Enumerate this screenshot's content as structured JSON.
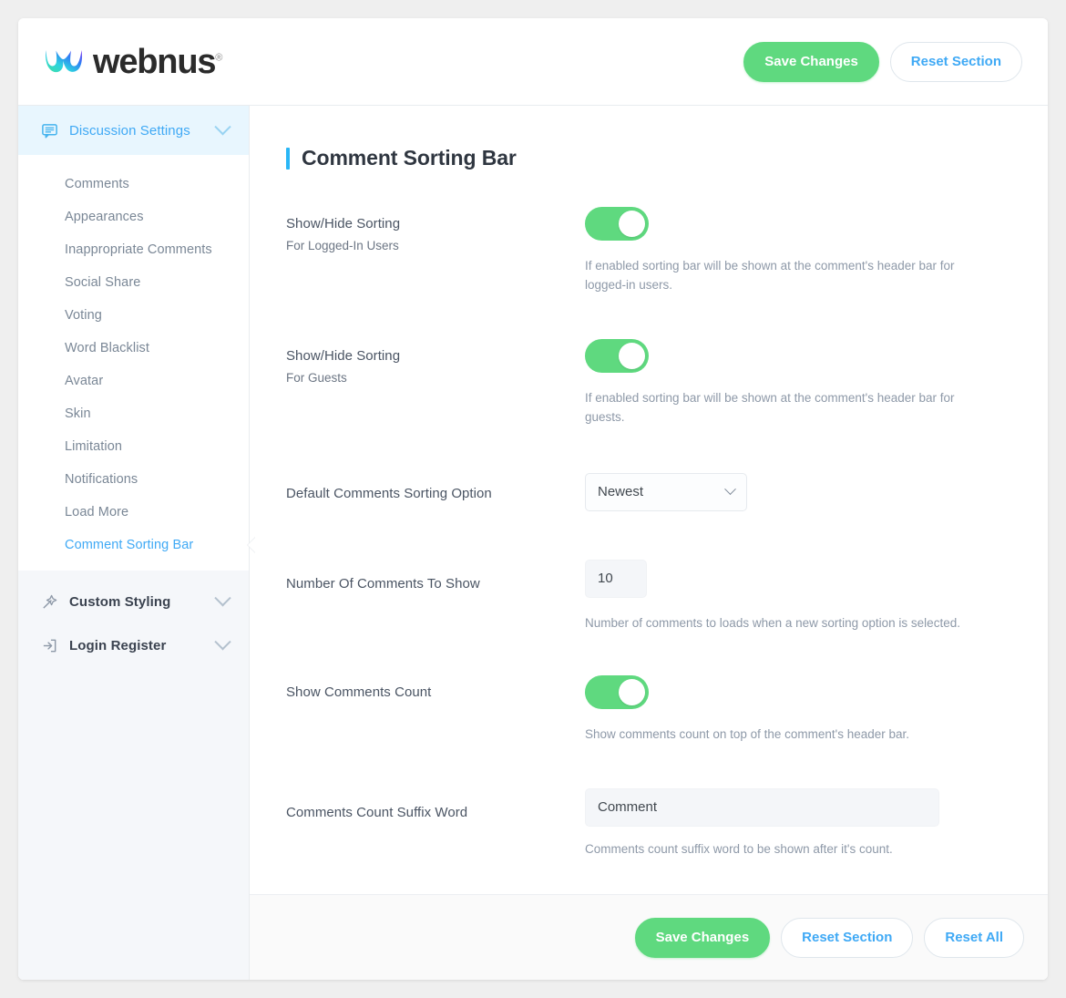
{
  "brand": {
    "name": "webnus",
    "registered_mark": "®",
    "logo_icon": "webnus-gradient-mark",
    "gradient": [
      "#3fe0a0",
      "#2ed3e0",
      "#2f7df5",
      "#8b3df0"
    ]
  },
  "topbar": {
    "save_label": "Save Changes",
    "reset_section_label": "Reset Section"
  },
  "sidebar": {
    "groups": [
      {
        "label": "Discussion Settings",
        "icon": "comment-bubble-icon",
        "active": true,
        "items": [
          {
            "label": "Comments",
            "active": false
          },
          {
            "label": "Appearances",
            "active": false
          },
          {
            "label": "Inappropriate Comments",
            "active": false
          },
          {
            "label": "Social Share",
            "active": false
          },
          {
            "label": "Voting",
            "active": false
          },
          {
            "label": "Word Blacklist",
            "active": false
          },
          {
            "label": "Avatar",
            "active": false
          },
          {
            "label": "Skin",
            "active": false
          },
          {
            "label": "Limitation",
            "active": false
          },
          {
            "label": "Notifications",
            "active": false
          },
          {
            "label": "Load More",
            "active": false
          },
          {
            "label": "Comment Sorting Bar",
            "active": true
          }
        ]
      },
      {
        "label": "Custom Styling",
        "icon": "magic-wand-icon",
        "active": false
      },
      {
        "label": "Login Register",
        "icon": "login-arrow-icon",
        "active": false
      }
    ]
  },
  "main": {
    "title": "Comment Sorting Bar",
    "fields": [
      {
        "label": "Show/Hide Sorting",
        "sublabel": "For Logged-In Users",
        "control": "toggle",
        "value": "on",
        "hint": "If enabled sorting bar will be shown at the comment's header bar for logged-in users."
      },
      {
        "label": "Show/Hide Sorting",
        "sublabel": "For Guests",
        "control": "toggle",
        "value": "on",
        "hint": "If enabled sorting bar will be shown at the comment's header bar for guests."
      },
      {
        "label": "Default Comments Sorting Option",
        "sublabel": "",
        "control": "select",
        "value": "Newest",
        "hint": ""
      },
      {
        "label": "Number Of Comments To Show",
        "sublabel": "",
        "control": "number",
        "value": "10",
        "hint": "Number of comments to loads when a new sorting option is selected."
      },
      {
        "label": "Show Comments Count",
        "sublabel": "",
        "control": "toggle",
        "value": "on",
        "hint": "Show comments count on top of the comment's header bar."
      },
      {
        "label": "Comments Count Suffix Word",
        "sublabel": "",
        "control": "text",
        "value": "Comment",
        "hint": "Comments count suffix word to be shown after it's count."
      }
    ]
  },
  "footer": {
    "save_label": "Save Changes",
    "reset_section_label": "Reset Section",
    "reset_all_label": "Reset All"
  },
  "colors": {
    "accent_green": "#5fd97f",
    "accent_blue": "#3fa9f5",
    "title_accent": "#29b6f6",
    "sidebar_active_bg": "#e8f6fe",
    "page_bg": "#efefef"
  }
}
